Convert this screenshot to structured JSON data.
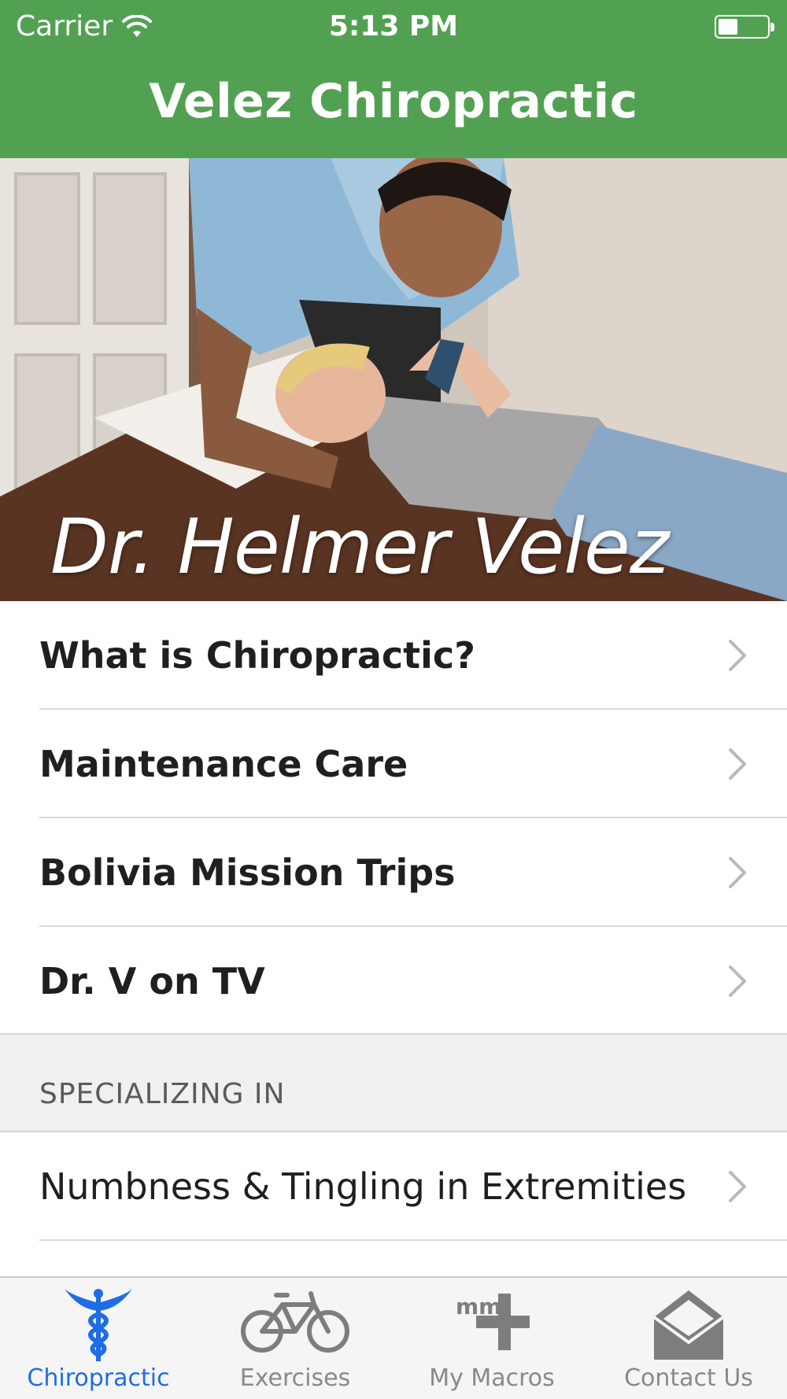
{
  "status_bar": {
    "carrier": "Carrier",
    "time": "5:13 PM",
    "wifi_icon": "wifi-icon",
    "battery_icon": "battery-icon"
  },
  "nav": {
    "title": "Velez Chiropractic"
  },
  "hero": {
    "caption": "Dr. Helmer Velez"
  },
  "menu_items": [
    {
      "label": "What is Chiropractic?"
    },
    {
      "label": "Maintenance Care"
    },
    {
      "label": "Bolivia Mission Trips"
    },
    {
      "label": "Dr. V on TV"
    }
  ],
  "specializing": {
    "header": "SPECIALIZING IN",
    "items": [
      {
        "label": "Numbness & Tingling in Extremities"
      }
    ]
  },
  "tabs": [
    {
      "label": "Chiropractic",
      "icon": "caduceus-icon",
      "active": true
    },
    {
      "label": "Exercises",
      "icon": "bicycle-icon",
      "active": false
    },
    {
      "label": "My Macros",
      "icon": "macros-plus-icon",
      "active": false
    },
    {
      "label": "Contact Us",
      "icon": "envelope-icon",
      "active": false
    }
  ],
  "colors": {
    "header_green": "#52a152",
    "active_tab": "#1e6de6",
    "inactive_tab": "#8a8a8a"
  }
}
